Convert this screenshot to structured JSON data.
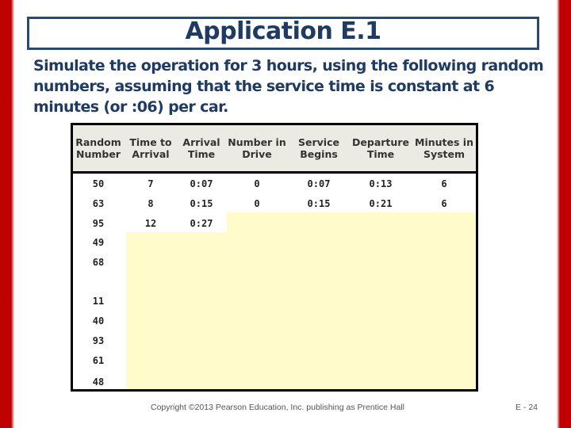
{
  "slide": {
    "title": "Application E.1",
    "intro": "Simulate the operation for 3 hours, using the following random numbers, assuming that the service time is constant at 6 minutes (or :06) per car.",
    "footer": "Copyright ©2013 Pearson Education, Inc. publishing as Prentice Hall",
    "page_number": "E - 24",
    "colors": {
      "border_red": "#c00000",
      "title_blue": "#1f3b63",
      "header_bg": "#ecebe3",
      "highlight_yellow": "#fffbcb"
    }
  },
  "table": {
    "headers": [
      "Random Number",
      "Time to Arrival",
      "Arrival Time",
      "Number in Drive",
      "Service Begins",
      "Departure Time",
      "Minutes in System"
    ],
    "rows": [
      [
        "50",
        "7",
        "0:07",
        "0",
        "0:07",
        "0:13",
        "6"
      ],
      [
        "63",
        "8",
        "0:15",
        "0",
        "0:15",
        "0:21",
        "6"
      ],
      [
        "95",
        "12",
        "0:27",
        "",
        "",
        "",
        ""
      ],
      [
        "49",
        "",
        "",
        "",
        "",
        "",
        ""
      ],
      [
        "68",
        "",
        "",
        "",
        "",
        "",
        ""
      ],
      [
        "11",
        "",
        "",
        "",
        "",
        "",
        ""
      ],
      [
        "40",
        "",
        "",
        "",
        "",
        "",
        ""
      ],
      [
        "93",
        "",
        "",
        "",
        "",
        "",
        ""
      ],
      [
        "61",
        "",
        "",
        "",
        "",
        "",
        ""
      ],
      [
        "48",
        "",
        "",
        "",
        "",
        "",
        ""
      ]
    ]
  }
}
